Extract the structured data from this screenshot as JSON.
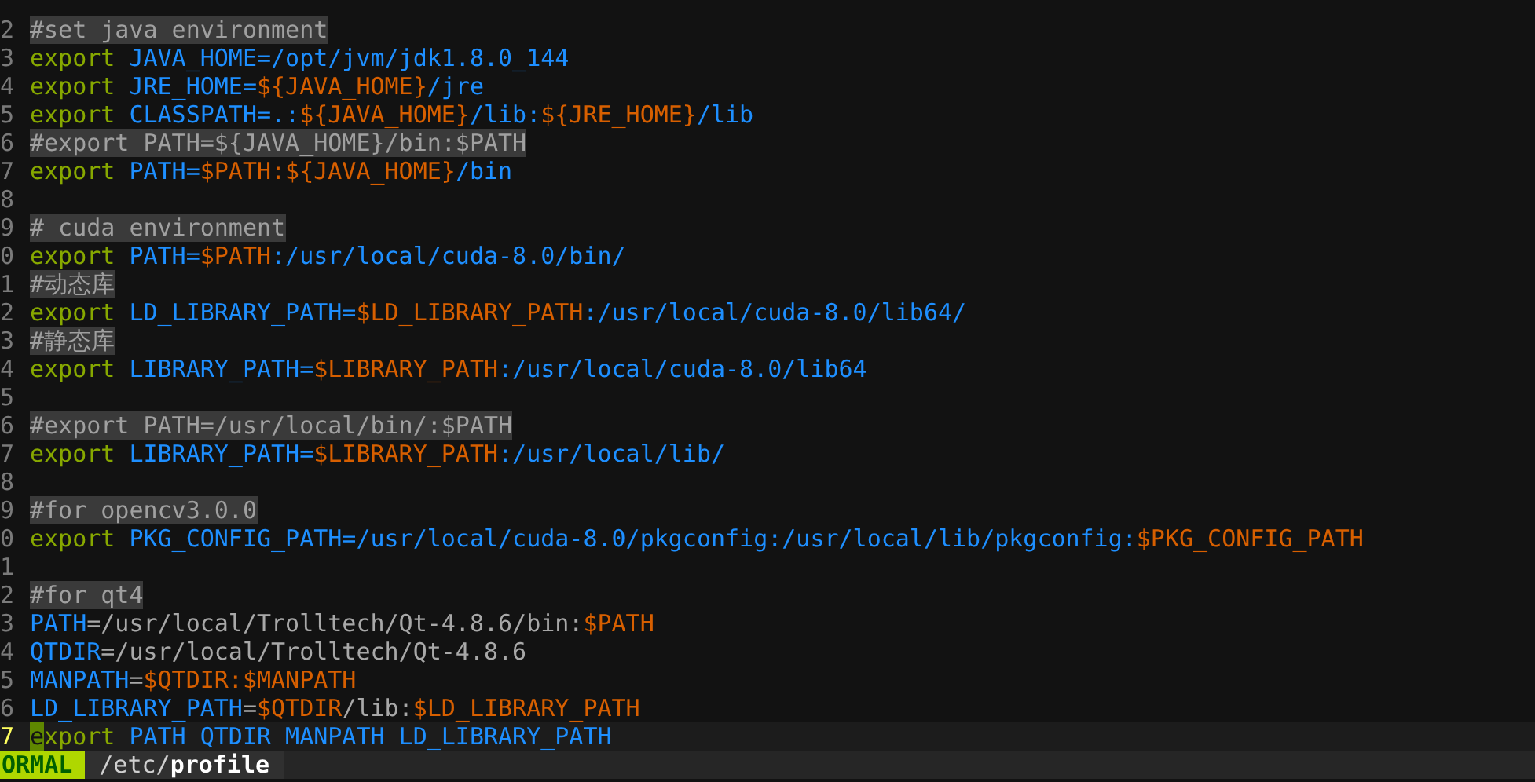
{
  "editor": {
    "lines": [
      {
        "number": "2",
        "current": false,
        "tokens": [
          {
            "kind": "comment",
            "text": "#set java environment"
          }
        ]
      },
      {
        "number": "3",
        "current": false,
        "tokens": [
          {
            "kind": "keyword",
            "text": "export "
          },
          {
            "kind": "value",
            "text": "JAVA_HOME=/opt/jvm/jdk1.8.0_144"
          }
        ]
      },
      {
        "number": "4",
        "current": false,
        "tokens": [
          {
            "kind": "keyword",
            "text": "export "
          },
          {
            "kind": "value",
            "text": "JRE_HOME="
          },
          {
            "kind": "ref",
            "text": "${JAVA_HOME}"
          },
          {
            "kind": "value",
            "text": "/jre"
          }
        ]
      },
      {
        "number": "5",
        "current": false,
        "tokens": [
          {
            "kind": "keyword",
            "text": "export "
          },
          {
            "kind": "value",
            "text": "CLASSPATH=.:"
          },
          {
            "kind": "ref",
            "text": "${JAVA_HOME}"
          },
          {
            "kind": "value",
            "text": "/lib:"
          },
          {
            "kind": "ref",
            "text": "${JRE_HOME}"
          },
          {
            "kind": "value",
            "text": "/lib"
          }
        ]
      },
      {
        "number": "6",
        "current": false,
        "tokens": [
          {
            "kind": "comment",
            "text": "#export PATH=${JAVA_HOME}/bin:$PATH"
          }
        ]
      },
      {
        "number": "7",
        "current": false,
        "tokens": [
          {
            "kind": "keyword",
            "text": "export "
          },
          {
            "kind": "value",
            "text": "PATH="
          },
          {
            "kind": "ref",
            "text": "$PATH:${JAVA_HOME}"
          },
          {
            "kind": "value",
            "text": "/bin"
          }
        ]
      },
      {
        "number": "8",
        "current": false
      },
      {
        "number": "9",
        "current": false,
        "tokens": [
          {
            "kind": "comment",
            "text": "# cuda environment"
          }
        ]
      },
      {
        "number": "0",
        "current": false,
        "tokens": [
          {
            "kind": "keyword",
            "text": "export "
          },
          {
            "kind": "value",
            "text": "PATH="
          },
          {
            "kind": "ref",
            "text": "$PATH"
          },
          {
            "kind": "value",
            "text": ":/usr/local/cuda-8.0/bin/"
          }
        ]
      },
      {
        "number": "1",
        "current": false,
        "tokens": [
          {
            "kind": "comment",
            "text": "#动态库"
          }
        ]
      },
      {
        "number": "2",
        "current": false,
        "tokens": [
          {
            "kind": "keyword",
            "text": "export "
          },
          {
            "kind": "value",
            "text": "LD_LIBRARY_PATH="
          },
          {
            "kind": "ref",
            "text": "$LD_LIBRARY_PATH"
          },
          {
            "kind": "value",
            "text": ":/usr/local/cuda-8.0/lib64/"
          }
        ]
      },
      {
        "number": "3",
        "current": false,
        "tokens": [
          {
            "kind": "comment",
            "text": "#静态库"
          }
        ]
      },
      {
        "number": "4",
        "current": false,
        "tokens": [
          {
            "kind": "keyword",
            "text": "export "
          },
          {
            "kind": "value",
            "text": "LIBRARY_PATH="
          },
          {
            "kind": "ref",
            "text": "$LIBRARY_PATH"
          },
          {
            "kind": "value",
            "text": ":/usr/local/cuda-8.0/lib64"
          }
        ]
      },
      {
        "number": "5",
        "current": false
      },
      {
        "number": "6",
        "current": false,
        "tokens": [
          {
            "kind": "comment",
            "text": "#export PATH=/usr/local/bin/:$PATH"
          }
        ]
      },
      {
        "number": "7",
        "current": false,
        "tokens": [
          {
            "kind": "keyword",
            "text": "export "
          },
          {
            "kind": "value",
            "text": "LIBRARY_PATH="
          },
          {
            "kind": "ref",
            "text": "$LIBRARY_PATH"
          },
          {
            "kind": "value",
            "text": ":/usr/local/lib/"
          }
        ]
      },
      {
        "number": "8",
        "current": false
      },
      {
        "number": "9",
        "current": false,
        "tokens": [
          {
            "kind": "comment",
            "text": "#for opencv3.0.0"
          }
        ]
      },
      {
        "number": "0",
        "current": false,
        "tokens": [
          {
            "kind": "keyword",
            "text": "export "
          },
          {
            "kind": "value",
            "text": "PKG_CONFIG_PATH=/usr/local/cuda-8.0/pkgconfig:/usr/local/lib/pkgconfig:"
          },
          {
            "kind": "ref",
            "text": "$PKG_CONFIG_PATH"
          }
        ]
      },
      {
        "number": "1",
        "current": false
      },
      {
        "number": "2",
        "current": false,
        "tokens": [
          {
            "kind": "comment",
            "text": "#for qt4"
          }
        ]
      },
      {
        "number": "3",
        "current": false,
        "tokens": [
          {
            "kind": "value",
            "text": "PATH"
          },
          {
            "kind": "text",
            "text": "=/usr/local/Trolltech/Qt-4.8.6/bin:"
          },
          {
            "kind": "ref",
            "text": "$PATH"
          }
        ]
      },
      {
        "number": "4",
        "current": false,
        "tokens": [
          {
            "kind": "value",
            "text": "QTDIR"
          },
          {
            "kind": "text",
            "text": "=/usr/local/Trolltech/Qt-4.8.6"
          }
        ]
      },
      {
        "number": "5",
        "current": false,
        "tokens": [
          {
            "kind": "value",
            "text": "MANPATH"
          },
          {
            "kind": "text",
            "text": "="
          },
          {
            "kind": "ref",
            "text": "$QTDIR:$MANPATH"
          }
        ]
      },
      {
        "number": "6",
        "current": false,
        "tokens": [
          {
            "kind": "value",
            "text": "LD_LIBRARY_PATH"
          },
          {
            "kind": "text",
            "text": "="
          },
          {
            "kind": "ref",
            "text": "$QTDIR"
          },
          {
            "kind": "text",
            "text": "/lib:"
          },
          {
            "kind": "ref",
            "text": "$LD_LIBRARY_PATH"
          }
        ]
      },
      {
        "number": "7",
        "current": true,
        "tokens": [
          {
            "kind": "keyword",
            "text": "export "
          },
          {
            "kind": "value",
            "text": "PATH QTDIR MANPATH LD_LIBRARY_PATH"
          }
        ]
      }
    ]
  },
  "status_bar": {
    "mode": "ORMAL",
    "path_dir": "/etc/",
    "file_name": "profile"
  }
}
